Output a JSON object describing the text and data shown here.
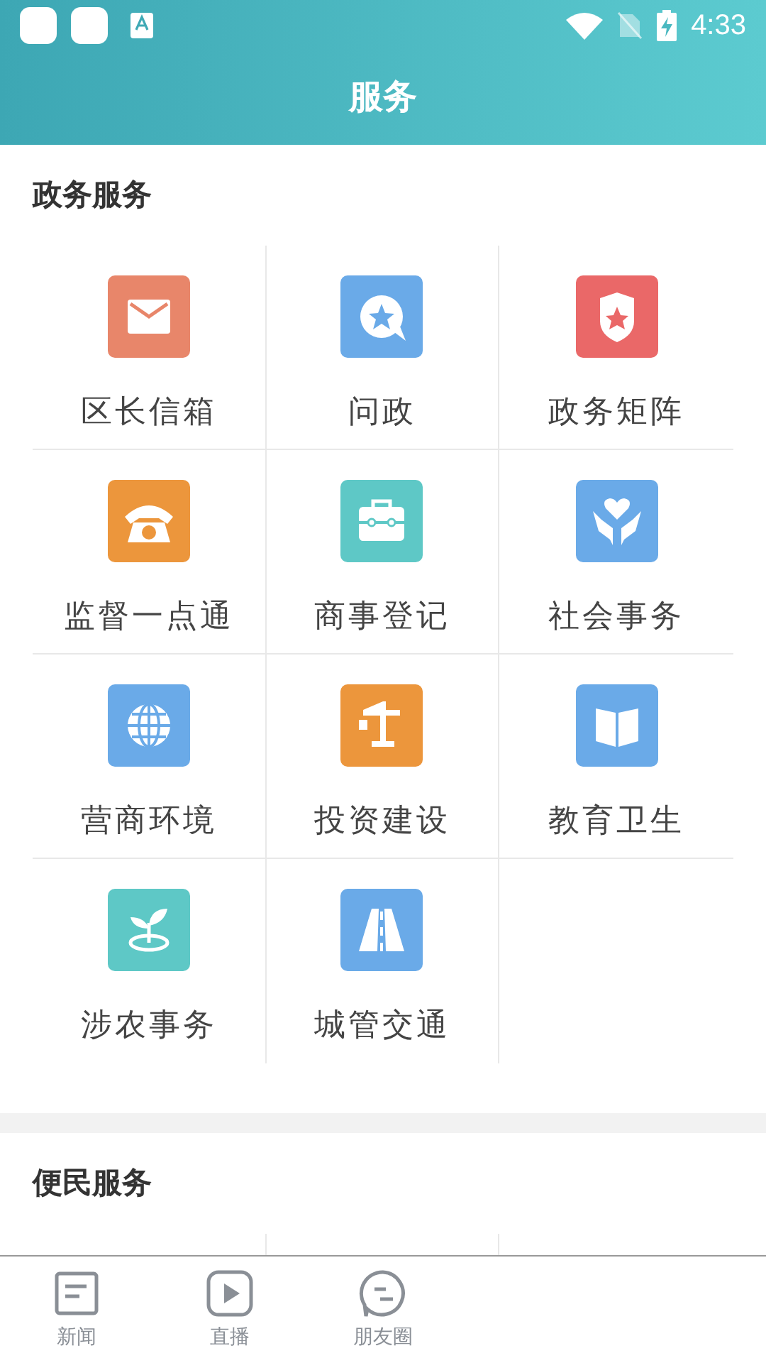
{
  "status_bar": {
    "time": "4:33"
  },
  "header": {
    "title": "服务"
  },
  "sections": [
    {
      "title": "政务服务",
      "items": [
        {
          "label": "区长信箱",
          "kind": "mail",
          "color": "#e8866a"
        },
        {
          "label": "问政",
          "kind": "star-chat",
          "color": "#6aaae8"
        },
        {
          "label": "政务矩阵",
          "kind": "badge",
          "color": "#ea6868"
        },
        {
          "label": "监督一点通",
          "kind": "phone",
          "color": "#ec963c"
        },
        {
          "label": "商事登记",
          "kind": "briefcase",
          "color": "#5ec8c6"
        },
        {
          "label": "社会事务",
          "kind": "hands",
          "color": "#6aaae8"
        },
        {
          "label": "营商环境",
          "kind": "globe",
          "color": "#6aaae8"
        },
        {
          "label": "投资建设",
          "kind": "crane",
          "color": "#ec963c"
        },
        {
          "label": "教育卫生",
          "kind": "book",
          "color": "#6aaae8"
        },
        {
          "label": "涉农事务",
          "kind": "sprout",
          "color": "#5ec8c6"
        },
        {
          "label": "城管交通",
          "kind": "road",
          "color": "#6aaae8"
        }
      ]
    },
    {
      "title": "便民服务"
    }
  ],
  "tab_bar": [
    {
      "label": "新闻",
      "kind": "news"
    },
    {
      "label": "直播",
      "kind": "play"
    },
    {
      "label": "朋友圈",
      "kind": "chat"
    }
  ]
}
